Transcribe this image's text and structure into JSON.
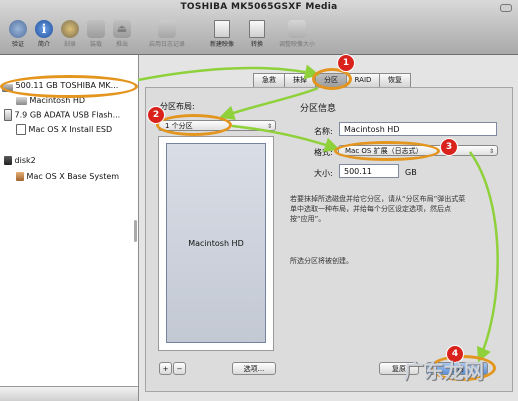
{
  "window": {
    "title": "TOSHIBA MK5065GSXF Media"
  },
  "toolbar": {
    "items": [
      {
        "label": "验证",
        "icon": "verify-icon",
        "enabled": true
      },
      {
        "label": "简介",
        "icon": "info-icon",
        "enabled": true
      },
      {
        "label": "刻录",
        "icon": "burn-icon",
        "enabled": false
      },
      {
        "label": "装载",
        "icon": "mount-icon",
        "enabled": false
      },
      {
        "label": "推出",
        "icon": "eject-icon",
        "enabled": false
      },
      {
        "label": "启用日志记录",
        "icon": "journal-icon",
        "enabled": false
      },
      {
        "label": "新建映像",
        "icon": "new-image-icon",
        "enabled": true
      },
      {
        "label": "转换",
        "icon": "convert-icon",
        "enabled": true
      },
      {
        "label": "调整映像大小",
        "icon": "resize-image-icon",
        "enabled": false
      }
    ]
  },
  "sidebar": {
    "items": [
      {
        "label": "500.11 GB TOSHIBA MK...",
        "icon": "hard-disk-icon"
      },
      {
        "label": "Macintosh HD",
        "icon": "volume-icon"
      },
      {
        "label": "7.9 GB ADATA USB Flash...",
        "icon": "usb-disk-icon"
      },
      {
        "label": "Mac OS X Install ESD",
        "icon": "volume-icon"
      },
      {
        "label": "disk2",
        "icon": "disk-image-icon"
      },
      {
        "label": "Mac OS X Base System",
        "icon": "volume-icon"
      }
    ]
  },
  "tabs": [
    "急救",
    "抹掉",
    "分区",
    "RAID",
    "恢复"
  ],
  "selected_tab": "分区",
  "partition": {
    "layout_label": "分区布局:",
    "layout_value": "1 个分区",
    "partition_name": "Macintosh HD",
    "plus_label": "+",
    "minus_label": "−",
    "options_label": "选项..."
  },
  "info": {
    "heading": "分区信息",
    "name_label": "名称:",
    "name_value": "Macintosh HD",
    "format_label": "格式:",
    "format_value": "Mac OS 扩展（日志式）",
    "size_label": "大小:",
    "size_value": "500.11",
    "size_unit": "GB",
    "help_lines": [
      "若要抹掉所选磁盘并给它分区，请从“分区布局”弹出式菜",
      "单中选取一种布局，并给每个分区设定选项，然后点",
      "按“应用”。"
    ],
    "status": "所选分区将被创建。"
  },
  "buttons": {
    "revert_label": "复原",
    "apply_label": "应用"
  },
  "annotations": [
    {
      "number": "1"
    },
    {
      "number": "2"
    },
    {
      "number": "3"
    },
    {
      "number": "4"
    }
  ],
  "watermark": "广东龙网",
  "colors": {
    "annotation_ring": "#e3951d",
    "arrow": "#8fd13a",
    "badge": "#d9221b"
  }
}
